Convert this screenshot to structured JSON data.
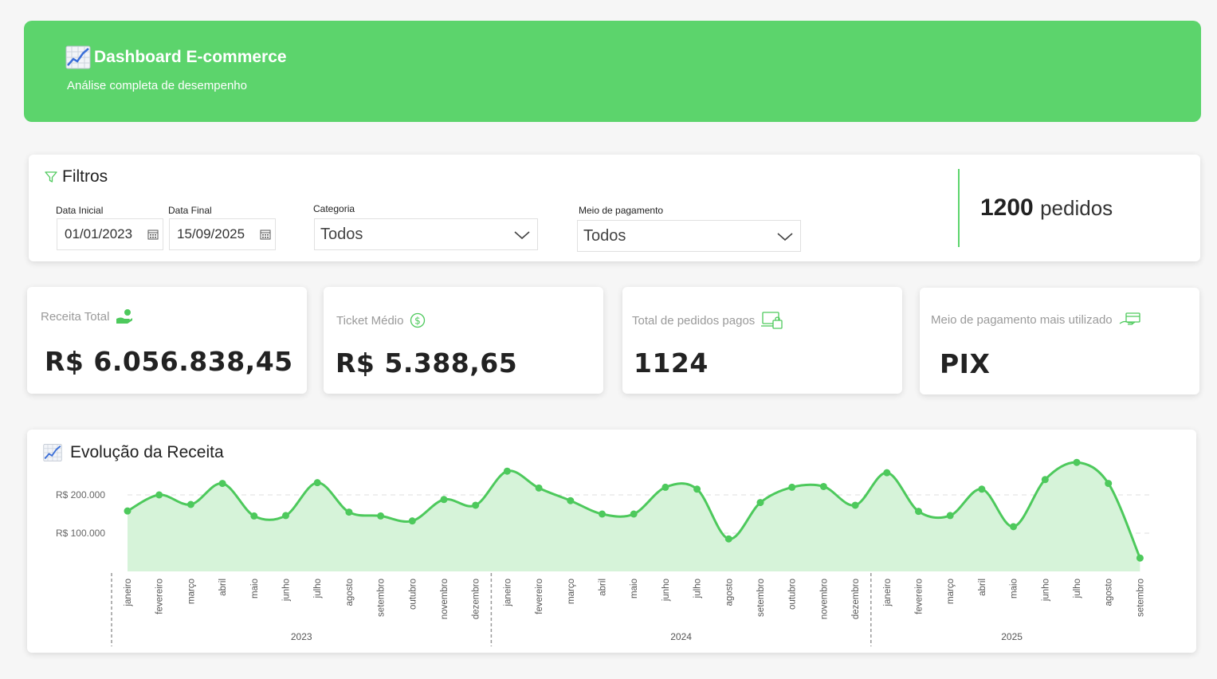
{
  "header": {
    "title": "Dashboard E-commerce",
    "subtitle": "Análise completa de desempenho",
    "icon": "chart-increasing-icon"
  },
  "filters": {
    "title": "Filtros",
    "start_date_label": "Data Inicial",
    "start_date_value": "01/01/2023",
    "end_date_label": "Data Final",
    "end_date_value": "15/09/2025",
    "category_label": "Categoria",
    "category_value": "Todos",
    "payment_label": "Meio de pagamento",
    "payment_value": "Todos",
    "orders_count": "1200",
    "orders_label": "pedidos"
  },
  "kpis": [
    {
      "label": "Receita Total",
      "value": "R$ 6.056.838,45",
      "icon": "hand-money-icon"
    },
    {
      "label": "Ticket Médio",
      "value": "R$ 5.388,65",
      "icon": "dollar-coin-icon"
    },
    {
      "label": "Total de pedidos pagos",
      "value": "1124",
      "icon": "laptop-bag-icon"
    },
    {
      "label": "Meio de pagamento mais utilizado",
      "value": "PIX",
      "icon": "card-payment-icon"
    }
  ],
  "colors": {
    "accent": "#5cd46c",
    "line": "#4dc95c",
    "fill": "#d6f3d9"
  },
  "chart_data": {
    "type": "area",
    "title": "Evolução da Receita",
    "y_ticks": [
      "R$ 100.000",
      "R$ 200.000"
    ],
    "y_tick_values": [
      100000,
      200000
    ],
    "ylim": [
      0,
      300000
    ],
    "grid": true,
    "years": [
      "2023",
      "2024",
      "2025"
    ],
    "x": [
      "janeiro",
      "fevereiro",
      "março",
      "abril",
      "maio",
      "junho",
      "julho",
      "agosto",
      "setembro",
      "outubro",
      "novembro",
      "dezembro",
      "janeiro",
      "fevereiro",
      "março",
      "abril",
      "maio",
      "junho",
      "julho",
      "agosto",
      "setembro",
      "outubro",
      "novembro",
      "dezembro",
      "janeiro",
      "fevereiro",
      "março",
      "abril",
      "maio",
      "junho",
      "julho",
      "agosto",
      "setembro"
    ],
    "year_of_x": [
      "2023",
      "2023",
      "2023",
      "2023",
      "2023",
      "2023",
      "2023",
      "2023",
      "2023",
      "2023",
      "2023",
      "2023",
      "2024",
      "2024",
      "2024",
      "2024",
      "2024",
      "2024",
      "2024",
      "2024",
      "2024",
      "2024",
      "2024",
      "2024",
      "2025",
      "2025",
      "2025",
      "2025",
      "2025",
      "2025",
      "2025",
      "2025",
      "2025"
    ],
    "series": [
      {
        "values": [
          158000,
          200000,
          175000,
          230000,
          145000,
          146000,
          232000,
          155000,
          145000,
          132000,
          188000,
          173000,
          262000,
          218000,
          185000,
          150000,
          150000,
          220000,
          215000,
          85000,
          180000,
          220000,
          222000,
          173000,
          258000,
          157000,
          146000,
          215000,
          117000,
          240000,
          285000,
          230000,
          35000
        ]
      }
    ]
  }
}
